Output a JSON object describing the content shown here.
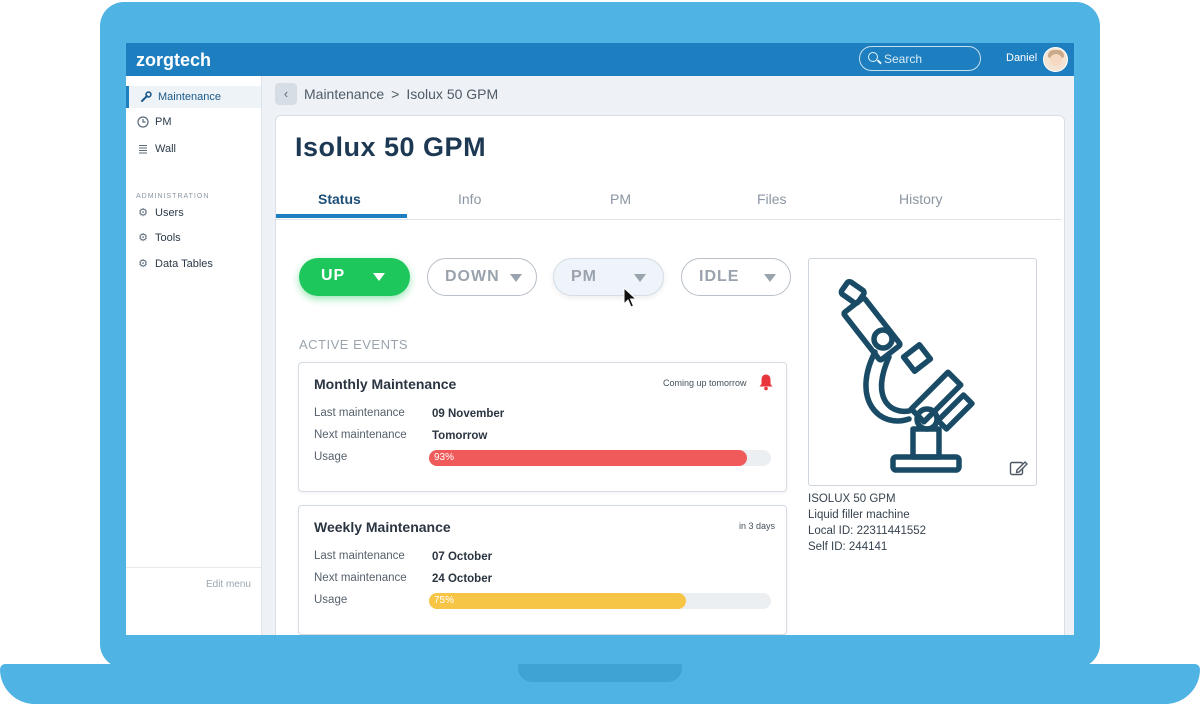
{
  "app": {
    "logo": "zorgtech"
  },
  "header": {
    "search_placeholder": "Search",
    "user_name": "Daniel"
  },
  "sidebar": {
    "items": [
      {
        "label": "Maintenance",
        "icon": "wrench-icon",
        "active": true
      },
      {
        "label": "PM",
        "icon": "clock-icon"
      },
      {
        "label": "Wall",
        "icon": "list-icon"
      }
    ],
    "section_title": "ADMINISTRATION",
    "admin_items": [
      {
        "label": "Users",
        "icon": "gear-icon"
      },
      {
        "label": "Tools",
        "icon": "gear-icon"
      },
      {
        "label": "Data Tables",
        "icon": "gear-icon"
      }
    ],
    "edit_menu": "Edit menu"
  },
  "breadcrumb": {
    "parent": "Maintenance",
    "separator": ">",
    "current": "Isolux 50 GPM"
  },
  "page": {
    "title": "Isolux 50 GPM"
  },
  "tabs": [
    {
      "label": "Status",
      "active": true
    },
    {
      "label": "Info"
    },
    {
      "label": "PM"
    },
    {
      "label": "Files"
    },
    {
      "label": "History"
    }
  ],
  "status_buttons": [
    {
      "label": "UP",
      "selected": true,
      "color": "#1dc75c"
    },
    {
      "label": "DOWN"
    },
    {
      "label": "PM",
      "hovered": true
    },
    {
      "label": "IDLE"
    }
  ],
  "active_events": {
    "title": "ACTIVE EVENTS",
    "events": [
      {
        "title": "Monthly Maintenance",
        "due": "Coming up tomorrow",
        "alert": true,
        "alert_color": "#e8353b",
        "last_label": "Last maintenance",
        "last_value": "09 November",
        "next_label": "Next maintenance",
        "next_value": "Tomorrow",
        "usage_label": "Usage",
        "usage_text": "93%",
        "usage_percent": 93,
        "bar_color": "#f05a5a"
      },
      {
        "title": "Weekly Maintenance",
        "due": "in 3 days",
        "alert": false,
        "last_label": "Last maintenance",
        "last_value": "07 October",
        "next_label": "Next maintenance",
        "next_value": "24 October",
        "usage_label": "Usage",
        "usage_text": "75%",
        "usage_percent": 75,
        "bar_color": "#f7c546"
      }
    ]
  },
  "machine": {
    "image_icon": "microscope-icon",
    "name": "ISOLUX 50 GPM",
    "type": "Liquid filler machine",
    "local_id": "Local ID: 22311441552",
    "self_id": "Self ID: 244141"
  },
  "colors": {
    "brand": "#1e7fc0",
    "title": "#1c3852",
    "frame": "#4fb3e3"
  }
}
